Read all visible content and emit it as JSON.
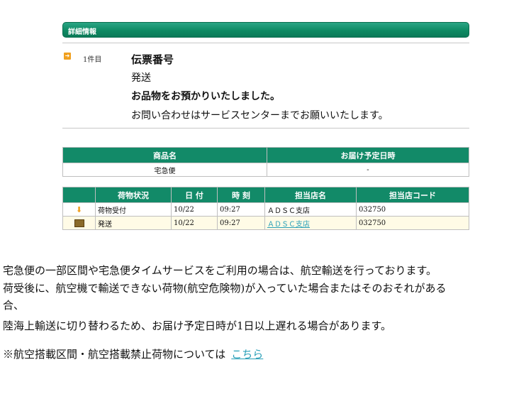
{
  "header": {
    "title": "詳細情報"
  },
  "item": {
    "count_label": "1件目",
    "lines": [
      "伝票番号",
      "発送",
      "お品物をお預かりいたしました。",
      "お問い合わせはサービスセンターまでお願いいたします。"
    ]
  },
  "product_table": {
    "headers": [
      "商品名",
      "お届け予定日時"
    ],
    "row": [
      "宅急便",
      "-"
    ]
  },
  "status_table": {
    "headers": [
      "荷物状況",
      "日 付",
      "時 刻",
      "担当店名",
      "担当店コード"
    ],
    "rows": [
      {
        "icon": "arrow-down-icon",
        "status": "荷物受付",
        "date": "10/22",
        "time": "09:27",
        "store": "ＡＤＳＣ支店",
        "code": "032750"
      },
      {
        "icon": "package-icon",
        "status": "発送",
        "date": "10/22",
        "time": "09:27",
        "store": "ＡＤＳＣ支店",
        "code": "032750"
      }
    ]
  },
  "notice": {
    "line1": "宅急便の一部区間や宅急便タイムサービスをご利用の場合は、航空輸送を行っております。",
    "line2": "荷受後に、航空機で輸送できない荷物(航空危険物)が入っていた場合またはそのおそれがある",
    "line3": "合、",
    "line4": "陸海上輸送に切り替わるため、お届け予定日時が1日以上遅れる場合があります。",
    "line5": "※航空搭載区間・航空搭載禁止荷物については",
    "link": "こちら"
  },
  "colors": {
    "header_green": "#128a68",
    "link": "#2aa0b8",
    "icon_orange": "#f0a020"
  }
}
